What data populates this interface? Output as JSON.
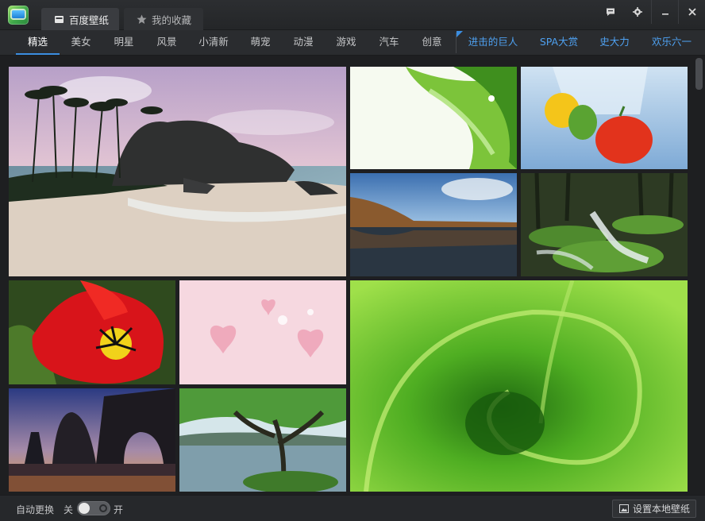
{
  "window": {
    "tabs": [
      {
        "label": "百度壁纸",
        "icon": "wallpaper-icon",
        "active": true
      },
      {
        "label": "我的收藏",
        "icon": "star-icon",
        "active": false
      }
    ],
    "controls": [
      "feedback-icon",
      "settings-icon",
      "minimize-icon",
      "close-icon"
    ]
  },
  "nav": {
    "categories": [
      "精选",
      "美女",
      "明星",
      "风景",
      "小清新",
      "萌宠",
      "动漫",
      "游戏",
      "汽车",
      "创意"
    ],
    "active_index": 0,
    "topics": [
      "进击的巨人",
      "SPA大赏",
      "史大力",
      "欢乐六一"
    ],
    "accent": "#3b8de0",
    "topic_color": "#4ea0ef"
  },
  "footer": {
    "auto_change_label": "自动更换",
    "off_label": "关",
    "on_label": "开",
    "auto_change_enabled": false,
    "set_local_label": "设置本地壁纸"
  }
}
